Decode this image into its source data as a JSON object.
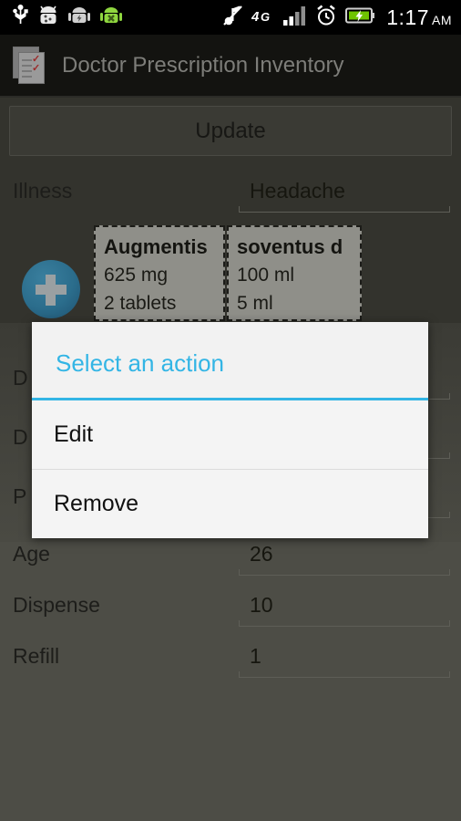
{
  "statusbar": {
    "left_icons": [
      "usb-icon",
      "android-debug-icon",
      "android-sync-icon",
      "android-error-icon"
    ],
    "right_icons": [
      "mute-icon",
      "network-4g-icon",
      "signal-bars-icon",
      "alarm-icon",
      "battery-charging-icon"
    ],
    "network_label": "4G",
    "time": "1:17",
    "ampm": "AM"
  },
  "actionbar": {
    "icon": "prescription-checklist-icon",
    "title": "Doctor Prescription Inventory"
  },
  "main": {
    "update_label": "Update",
    "illness": {
      "label": "Illness",
      "value": "Headache"
    },
    "add_button_icon": "plus-icon",
    "medicines": [
      {
        "name": "Augmentis",
        "dose": "625 mg",
        "quantity": "2 tablets"
      },
      {
        "name": "soventus d",
        "dose": "100 ml",
        "quantity": "5 ml"
      }
    ],
    "obscured_rows": [
      {
        "label": "D",
        "value": ""
      },
      {
        "label": "D",
        "value": ""
      },
      {
        "label": "P",
        "value": ""
      }
    ],
    "rows": [
      {
        "label": "Age",
        "value": "26"
      },
      {
        "label": "Dispense",
        "value": "10"
      },
      {
        "label": "Refill",
        "value": "1"
      }
    ]
  },
  "dialog": {
    "title": "Select an action",
    "accent_color": "#33b5e5",
    "items": [
      {
        "label": "Edit"
      },
      {
        "label": "Remove"
      }
    ]
  }
}
